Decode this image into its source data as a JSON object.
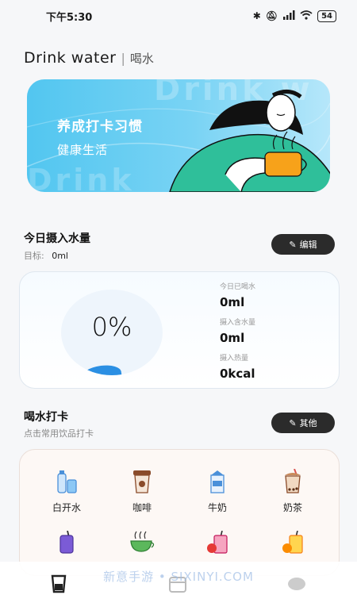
{
  "status_bar": {
    "time": "下午5:30",
    "battery": "54"
  },
  "header": {
    "title_en": "Drink water",
    "separator": "|",
    "title_cn": "喝水"
  },
  "banner": {
    "headline": "养成打卡习惯",
    "subline": "健康生活",
    "watermark_top": "Drink w",
    "watermark_bottom": "Drink"
  },
  "intake": {
    "title": "今日摄入水量",
    "target_label": "目标:",
    "target_value": "0ml",
    "edit_button": "编辑",
    "percent": "0%",
    "progress_fraction": 0,
    "stats": [
      {
        "label": "今日已喝水",
        "value": "0ml"
      },
      {
        "label": "摄入含水量",
        "value": "0ml"
      },
      {
        "label": "摄入热量",
        "value": "0kcal"
      }
    ]
  },
  "checkin": {
    "title": "喝水打卡",
    "subtitle": "点击常用饮品打卡",
    "other_button": "其他",
    "drinks": [
      {
        "label": "白开水",
        "icon": "water-bottle-icon"
      },
      {
        "label": "咖啡",
        "icon": "coffee-icon"
      },
      {
        "label": "牛奶",
        "icon": "milk-icon"
      },
      {
        "label": "奶茶",
        "icon": "milk-tea-icon"
      },
      {
        "label": "",
        "icon": "juice-cup-icon"
      },
      {
        "label": "",
        "icon": "tea-cup-icon"
      },
      {
        "label": "",
        "icon": "fruit-juice-icon"
      },
      {
        "label": "",
        "icon": "orange-juice-icon"
      }
    ]
  },
  "watermark": "新意手游 • SIXINYI.COM",
  "colors": {
    "banner": "#52c6f0",
    "accent_blue": "#2b8fe3",
    "button_dark": "#2b2b2b"
  }
}
